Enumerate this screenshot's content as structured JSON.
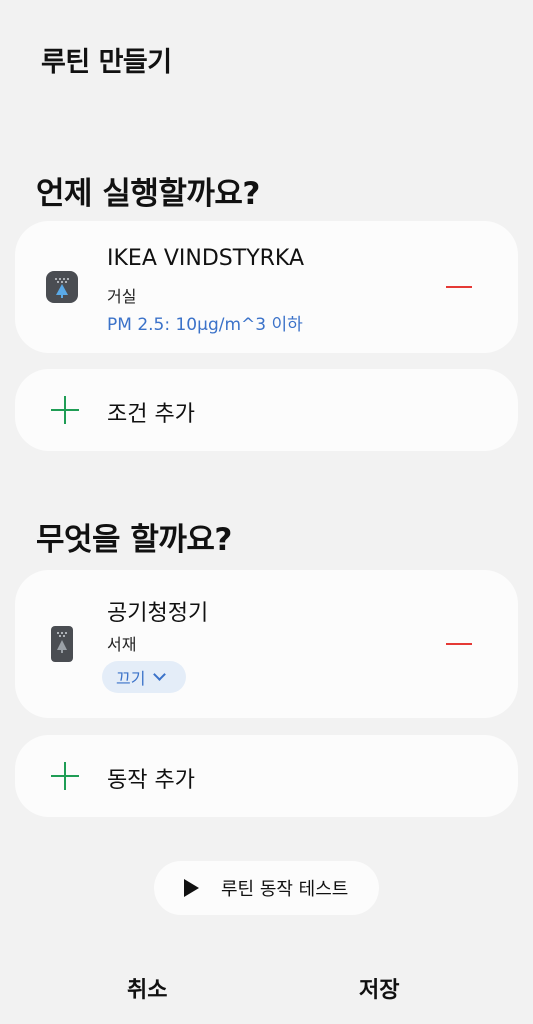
{
  "header": {
    "title": "루틴 만들기"
  },
  "when_section": {
    "title": "언제 실행할까요?",
    "device": {
      "name": "IKEA VINDSTYRKA",
      "room": "거실",
      "condition": "PM 2.5: 10µg/m^3 이하",
      "icon": "air-quality-sensor-icon"
    },
    "add_label": "조건 추가"
  },
  "what_section": {
    "title": "무엇을 할까요?",
    "device": {
      "name": "공기청정기",
      "room": "서재",
      "action": "끄기",
      "icon": "air-purifier-icon"
    },
    "add_label": "동작 추가"
  },
  "test_button": {
    "label": "루틴 동작 테스트"
  },
  "footer": {
    "cancel_label": "취소",
    "save_label": "저장"
  },
  "colors": {
    "background": "#f2f2f2",
    "card": "#fcfcfc",
    "accent_blue": "#3b72c9",
    "remove_red": "#e53935",
    "add_green": "#1f9d55"
  }
}
